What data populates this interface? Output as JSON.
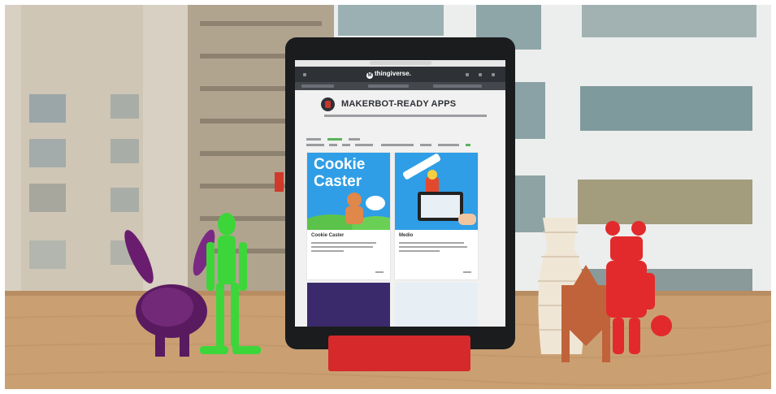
{
  "screen": {
    "brand": "thingiverse.",
    "heading": "MAKERBOT-READY APPS",
    "cards": [
      {
        "art_text": "Cookie Caster",
        "title": "Cookie Caster"
      },
      {
        "title": "Medio"
      }
    ]
  },
  "colors": {
    "stand": "#d6292b",
    "screen_blue": "#2f9ee6",
    "nav_bar": "#2e3136",
    "accent_red": "#c9372c"
  }
}
